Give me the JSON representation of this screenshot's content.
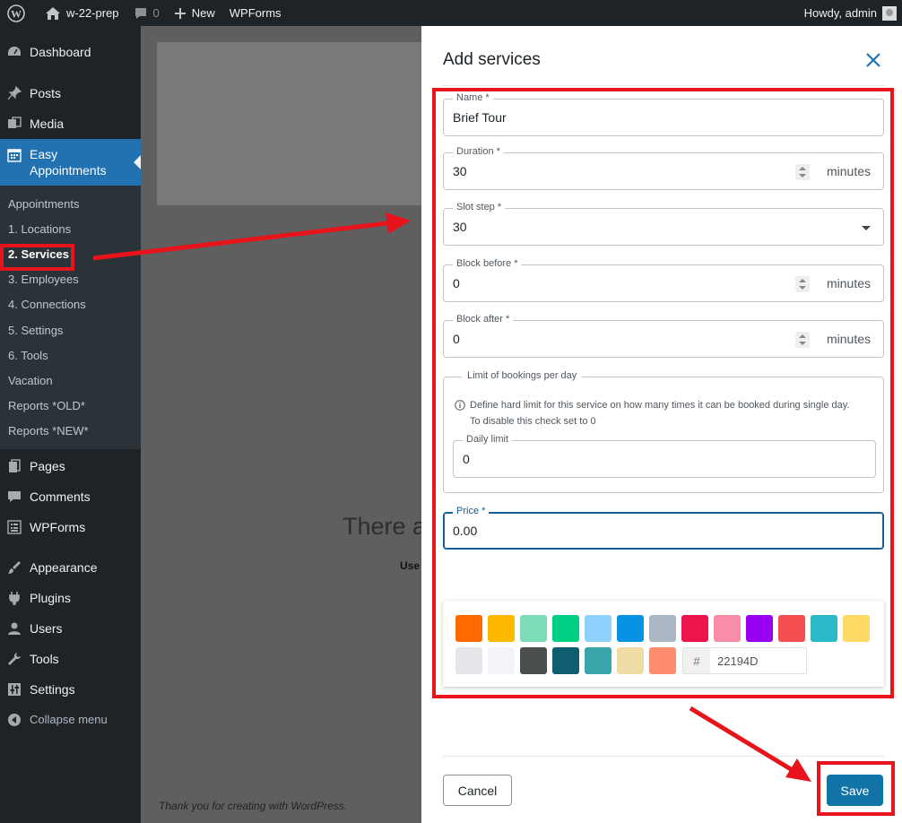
{
  "adminbar": {
    "site_name": "w-22-prep",
    "comments_count": "0",
    "new_label": "New",
    "wpforms_label": "WPForms",
    "howdy": "Howdy, admin"
  },
  "sidebar": {
    "dashboard": "Dashboard",
    "posts": "Posts",
    "media": "Media",
    "easy_appointments": "Easy Appointments",
    "submenu": [
      "Appointments",
      "1. Locations",
      "2. Services",
      "3. Employees",
      "4. Connections",
      "5. Settings",
      "6. Tools",
      "Vacation",
      "Reports *OLD*",
      "Reports *NEW*"
    ],
    "pages": "Pages",
    "comments": "Comments",
    "wpforms": "WPForms",
    "appearance": "Appearance",
    "plugins": "Plugins",
    "users": "Users",
    "tools": "Tools",
    "settings": "Settings",
    "collapse": "Collapse menu"
  },
  "main": {
    "big_text": "There a",
    "use_text": "Use",
    "footer": "Thank you for creating with WordPress."
  },
  "panel": {
    "title": "Add services",
    "name": {
      "label": "Name *",
      "value": "Brief Tour"
    },
    "duration": {
      "label": "Duration *",
      "value": "30",
      "unit": "minutes"
    },
    "slot_step": {
      "label": "Slot step *",
      "value": "30"
    },
    "block_before": {
      "label": "Block before *",
      "value": "0",
      "unit": "minutes"
    },
    "block_after": {
      "label": "Block after *",
      "value": "0",
      "unit": "minutes"
    },
    "limit": {
      "label": "Limit of bookings per day",
      "info_line1": "Define hard limit for this service on how many times it can be booked during single day.",
      "info_line2": "To disable this check set to 0",
      "daily": {
        "label": "Daily limit",
        "value": "0"
      }
    },
    "price": {
      "label": "Price *",
      "value": "0.00"
    },
    "colors": {
      "row1": [
        "#FF6900",
        "#FCB900",
        "#7BDCB5",
        "#00D084",
        "#8ED1FC",
        "#0693E3",
        "#ABB8C3",
        "#EB144C",
        "#F78DA7",
        "#9900EF",
        "#F44E4E",
        "#2CB8C6",
        "#FFD966"
      ],
      "row2": [
        "#E6E6EA",
        "#F4F4F8",
        "#4A4E4D",
        "#0E5E6F",
        "#3AA6A9",
        "#F0DCA5",
        "#FF8B6E"
      ],
      "hash": "#",
      "hex_value": "22194D"
    },
    "cancel_label": "Cancel",
    "save_label": "Save"
  }
}
